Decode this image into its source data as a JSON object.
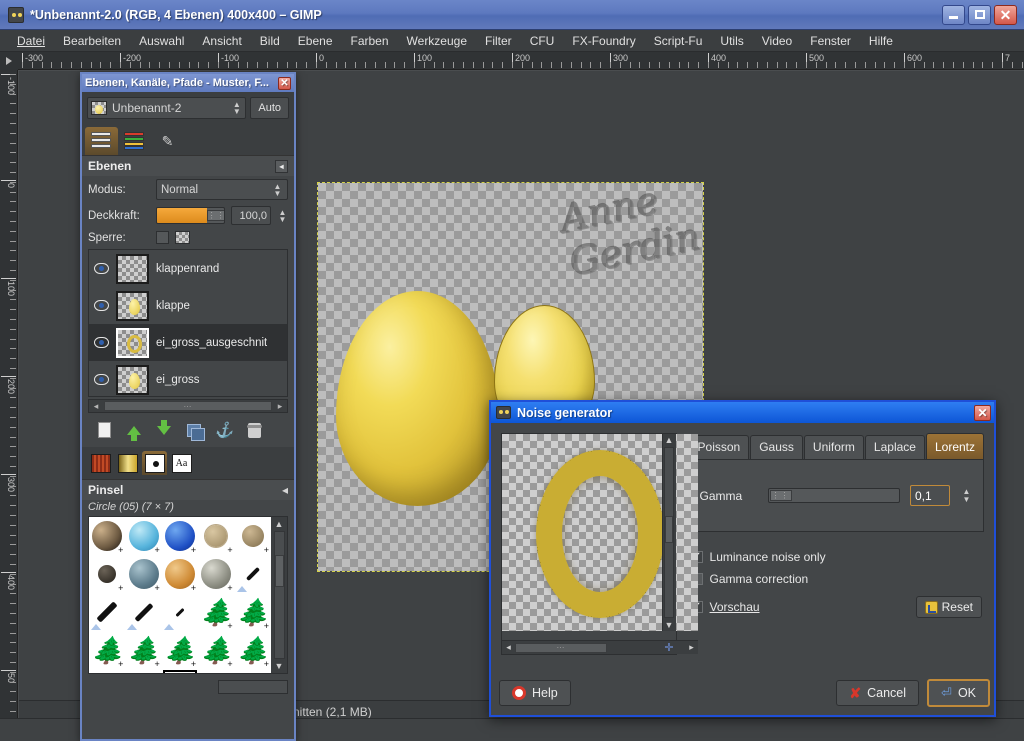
{
  "window": {
    "title": "*Unbenannt-2.0 (RGB, 4 Ebenen) 400x400 – GIMP",
    "minimize_label": "_",
    "maximize_label": "□",
    "close_label": "✕",
    "titlebar_icon": "gimp-wilber-icon"
  },
  "menubar": {
    "items": [
      {
        "label": "Datei"
      },
      {
        "label": "Bearbeiten"
      },
      {
        "label": "Auswahl"
      },
      {
        "label": "Ansicht"
      },
      {
        "label": "Bild"
      },
      {
        "label": "Ebene"
      },
      {
        "label": "Farben"
      },
      {
        "label": "Werkzeuge"
      },
      {
        "label": "Filter"
      },
      {
        "label": "CFU"
      },
      {
        "label": "FX-Foundry"
      },
      {
        "label": "Script-Fu"
      },
      {
        "label": "Utils"
      },
      {
        "label": "Video"
      },
      {
        "label": "Fenster"
      },
      {
        "label": "Hilfe"
      }
    ]
  },
  "rulers": {
    "horizontal_labels": [
      "-300",
      "-200",
      "-100",
      "0",
      "100",
      "200",
      "300",
      "400",
      "500",
      "600",
      "7"
    ],
    "vertical_labels": [
      "-100",
      "0",
      "100",
      "200",
      "300",
      "400",
      "50"
    ]
  },
  "statusbar": {
    "text": "nitten (2,1 MB)"
  },
  "canvas": {
    "watermark_text": "Anne Gerdin"
  },
  "dock": {
    "title": "Ebenen, Kanäle, Pfade - Muster, F...",
    "close_label": "✕",
    "image_name": "Unbenannt-2",
    "auto_label": "Auto",
    "tabs": [
      {
        "name": "layers-tab",
        "icon": "layers-icon",
        "active": true
      },
      {
        "name": "channels-tab",
        "icon": "channels-icon",
        "active": false
      },
      {
        "name": "paths-tab",
        "icon": "paths-icon",
        "active": false
      }
    ],
    "layers_section": {
      "heading": "Ebenen",
      "mode_label": "Modus:",
      "mode_value": "Normal",
      "opacity_label": "Deckkraft:",
      "opacity_value": "100,0",
      "lock_label": "Sperre:",
      "layers": [
        {
          "name": "klappenrand",
          "visible": true,
          "selected": false,
          "thumb": "empty"
        },
        {
          "name": "klappe",
          "visible": true,
          "selected": false,
          "thumb": "egg"
        },
        {
          "name": "ei_gross_ausgeschnit",
          "visible": true,
          "selected": true,
          "thumb": "ring"
        },
        {
          "name": "ei_gross",
          "visible": true,
          "selected": false,
          "thumb": "egg"
        }
      ],
      "buttons": [
        {
          "name": "new-layer-button",
          "icon": "new-layer-icon"
        },
        {
          "name": "raise-layer-button",
          "icon": "arrow-up-icon"
        },
        {
          "name": "lower-layer-button",
          "icon": "arrow-down-icon"
        },
        {
          "name": "duplicate-layer-button",
          "icon": "duplicate-icon"
        },
        {
          "name": "anchor-layer-button",
          "icon": "anchor-icon"
        },
        {
          "name": "delete-layer-button",
          "icon": "trash-icon"
        }
      ]
    },
    "brush_section": {
      "tabs": [
        {
          "name": "patterns-tab",
          "icon": "pattern-swatch-icon",
          "active": false
        },
        {
          "name": "gradients-tab",
          "icon": "gradient-swatch-icon",
          "active": false
        },
        {
          "name": "brushes-tab",
          "icon": "brush-swatch-icon",
          "active": true
        },
        {
          "name": "fonts-tab",
          "icon": "font-swatch-icon",
          "label": "Aa",
          "active": false
        }
      ],
      "heading": "Pinsel",
      "current_brush": "Circle (05) (7 × 7)"
    }
  },
  "noise_dialog": {
    "title": "Noise generator",
    "title_icon": "gimp-wilber-icon",
    "close_label": "✕",
    "tabs": [
      {
        "label": "Poisson",
        "active": false
      },
      {
        "label": "Gauss",
        "active": false
      },
      {
        "label": "Uniform",
        "active": false
      },
      {
        "label": "Laplace",
        "active": false
      },
      {
        "label": "Lorentz",
        "active": true
      }
    ],
    "gamma_label": "Gamma",
    "gamma_value": "0,1",
    "options": [
      {
        "label": "Luminance noise only",
        "checked": true
      },
      {
        "label": "Gamma correction",
        "checked": false
      }
    ],
    "preview_label": "Vorschau",
    "preview_checked": true,
    "reset_label": "Reset",
    "help_label": "Help",
    "cancel_label": "Cancel",
    "ok_label": "OK"
  },
  "colors": {
    "titlebar_blue": "#5d79bf",
    "dialog_blue": "#0d56d6",
    "accent_orange": "#c08a3a",
    "panel_bg": "#434648",
    "egg_yellow": "#e2c63f"
  }
}
